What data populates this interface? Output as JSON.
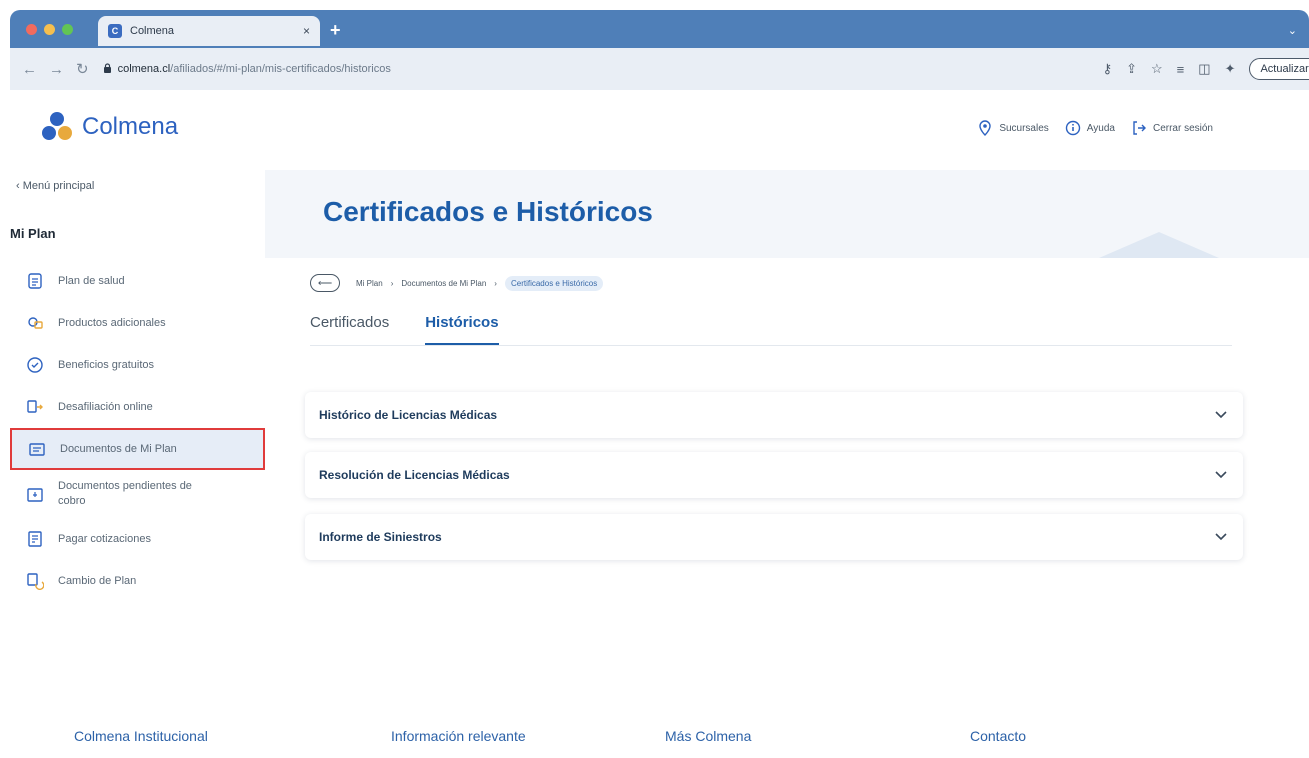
{
  "browser": {
    "tab_title": "Colmena",
    "tab_close": "×",
    "new_tab": "+",
    "tab_menu": "⌄",
    "url_host": "colmena.cl",
    "url_path": "/afiliados/#/mi-plan/mis-certificados/historicos",
    "update_button": "Actualizar"
  },
  "brand": {
    "name": "Colmena"
  },
  "header": {
    "links": [
      {
        "label": "Sucursales",
        "icon": "location-pin-icon"
      },
      {
        "label": "Ayuda",
        "icon": "info-icon"
      },
      {
        "label": "Cerrar sesión",
        "icon": "logout-icon"
      }
    ]
  },
  "sidebar": {
    "back_label": "‹ Menú principal",
    "section_title": "Mi Plan",
    "items": [
      {
        "label": "Plan de salud",
        "icon": "health-plan-icon",
        "active": false
      },
      {
        "label": "Productos adicionales",
        "icon": "products-icon",
        "active": false
      },
      {
        "label": "Beneficios gratuitos",
        "icon": "benefits-icon",
        "active": false
      },
      {
        "label": "Desafiliación online",
        "icon": "disaffiliation-icon",
        "active": false
      },
      {
        "label": "Documentos de Mi Plan",
        "icon": "documents-icon",
        "active": true
      },
      {
        "label": "Documentos pendientes de cobro",
        "icon": "pending-documents-icon",
        "active": false
      },
      {
        "label": "Pagar cotizaciones",
        "icon": "pay-icon",
        "active": false
      },
      {
        "label": "Cambio de Plan",
        "icon": "plan-change-icon",
        "active": false
      }
    ]
  },
  "main": {
    "title": "Certificados e Históricos",
    "breadcrumb": {
      "back": "⟵",
      "items": [
        "Mi Plan",
        "Documentos de Mi Plan",
        "Certificados e Históricos"
      ],
      "separator": "›"
    },
    "tabs": [
      {
        "label": "Certificados",
        "active": false
      },
      {
        "label": "Históricos",
        "active": true
      }
    ],
    "accordions": [
      {
        "title": "Histórico de Licencias Médicas"
      },
      {
        "title": "Resolución de Licencias Médicas"
      },
      {
        "title": "Informe de Siniestros"
      }
    ]
  },
  "footer": {
    "columns": [
      "Colmena Institucional",
      "Información relevante",
      "Más Colmena",
      "Contacto"
    ]
  },
  "colors": {
    "brand_blue": "#2d62c0",
    "title_blue": "#1d5da8",
    "highlight_red": "#e03b3b",
    "chrome_blue": "#4f7fb8"
  }
}
